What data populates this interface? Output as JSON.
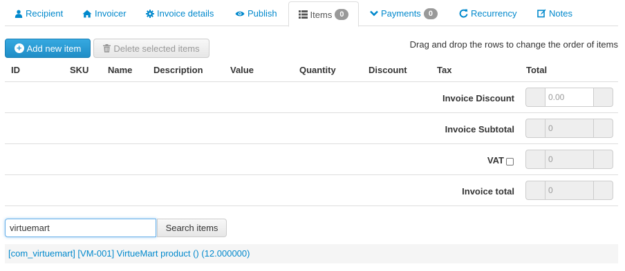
{
  "tabs": [
    {
      "label": "Recipient",
      "icon": "user-icon"
    },
    {
      "label": "Invoicer",
      "icon": "home-icon"
    },
    {
      "label": "Invoice details",
      "icon": "gear-icon"
    },
    {
      "label": "Publish",
      "icon": "eye-icon"
    },
    {
      "label": "Items",
      "icon": "list-icon",
      "badge": "0",
      "active": true
    },
    {
      "label": "Payments",
      "icon": "chevron-down-icon",
      "badge": "0"
    },
    {
      "label": "Recurrency",
      "icon": "refresh-icon"
    },
    {
      "label": "Notes",
      "icon": "edit-icon"
    }
  ],
  "toolbar": {
    "add_label": "Add new item",
    "delete_label": "Delete selected items",
    "hint": "Drag and drop the rows to change the order of items"
  },
  "table": {
    "columns": [
      "ID",
      "SKU",
      "Name",
      "Description",
      "Value",
      "Quantity",
      "Discount",
      "Tax",
      "Total"
    ]
  },
  "summary": {
    "discount_label": "Invoice Discount",
    "discount_placeholder": "0.00",
    "subtotal_label": "Invoice Subtotal",
    "subtotal_value": "0",
    "vat_label": "VAT",
    "vat_value": "0",
    "total_label": "Invoice total",
    "total_value": "0"
  },
  "search": {
    "value": "virtuemart",
    "button_label": "Search items",
    "result": "[com_virtuemart] [VM-001] VirtueMart product () (12.000000)"
  },
  "colors": {
    "link": "#0088cc",
    "primary_button": "#2a9ad4",
    "badge": "#999999"
  }
}
